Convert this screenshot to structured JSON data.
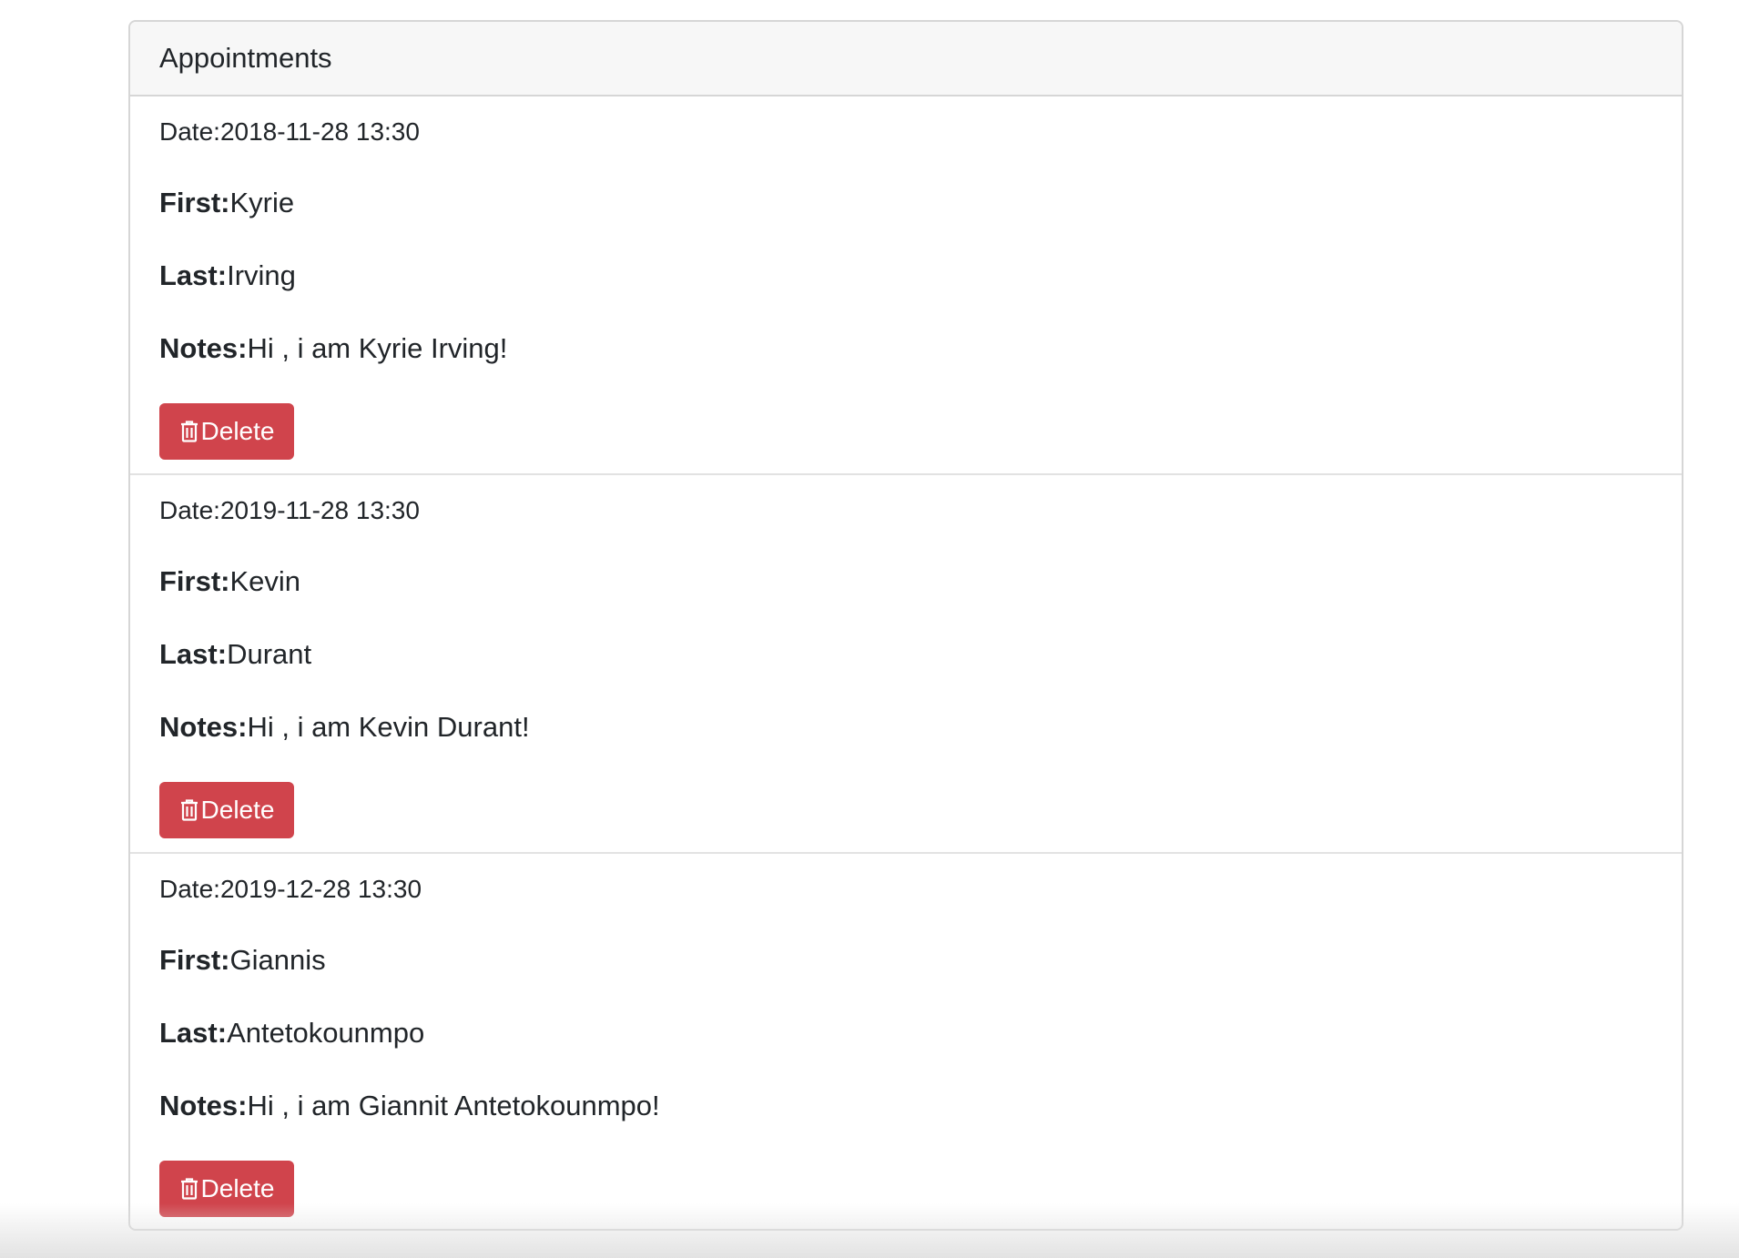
{
  "panel": {
    "title": "Appointments"
  },
  "appointments": [
    {
      "date_label": "Date:",
      "date": "2018-11-28 13:30",
      "first_label": "First:",
      "first": "Kyrie",
      "last_label": "Last:",
      "last": "Irving",
      "notes_label": "Notes:",
      "notes": "Hi , i am Kyrie Irving!",
      "delete_label": "Delete",
      "delete_icon": "trash-icon"
    },
    {
      "date_label": "Date:",
      "date": "2019-11-28 13:30",
      "first_label": "First:",
      "first": "Kevin",
      "last_label": "Last:",
      "last": "Durant",
      "notes_label": "Notes:",
      "notes": "Hi , i am Kevin Durant!",
      "delete_label": "Delete",
      "delete_icon": "trash-icon"
    },
    {
      "date_label": "Date:",
      "date": "2019-12-28 13:30",
      "first_label": "First:",
      "first": "Giannis",
      "last_label": "Last:",
      "last": "Antetokounmpo",
      "notes_label": "Notes:",
      "notes": "Hi , i am Giannit Antetokounmpo!",
      "delete_label": "Delete",
      "delete_icon": "trash-icon"
    }
  ],
  "colors": {
    "danger": "#d0444c",
    "header_bg": "#f7f7f7",
    "border": "#d6d6d6",
    "text": "#212529"
  }
}
